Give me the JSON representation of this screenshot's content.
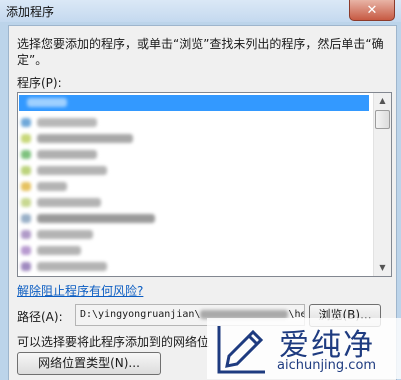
{
  "window": {
    "title": "添加程序",
    "close_glyph": "✕"
  },
  "dialog": {
    "description": "选择您要添加的程序，或单击“浏览”查找未列出的程序，然后单击“确定”。",
    "list_label": "程序(P):",
    "unblock_link": "解除阻止程序有何风险?",
    "path_label": "路径(A):",
    "path_prefix": "D:\\yingyongruanjian\\",
    "path_suffix": "\\he",
    "browse_button": "浏览(B)...",
    "network_hint": "可以选择要将此程序添加到的网络位",
    "network_button": "网络位置类型(N)..."
  },
  "scrollbar": {
    "up_glyph": "▲",
    "down_glyph": "▼"
  },
  "watermark": {
    "brand": "爱纯净",
    "url": "aichunjing.com",
    "color": "#1e3b80"
  },
  "colors": {
    "selection": "#3399ff",
    "link": "#0b5dc2"
  }
}
